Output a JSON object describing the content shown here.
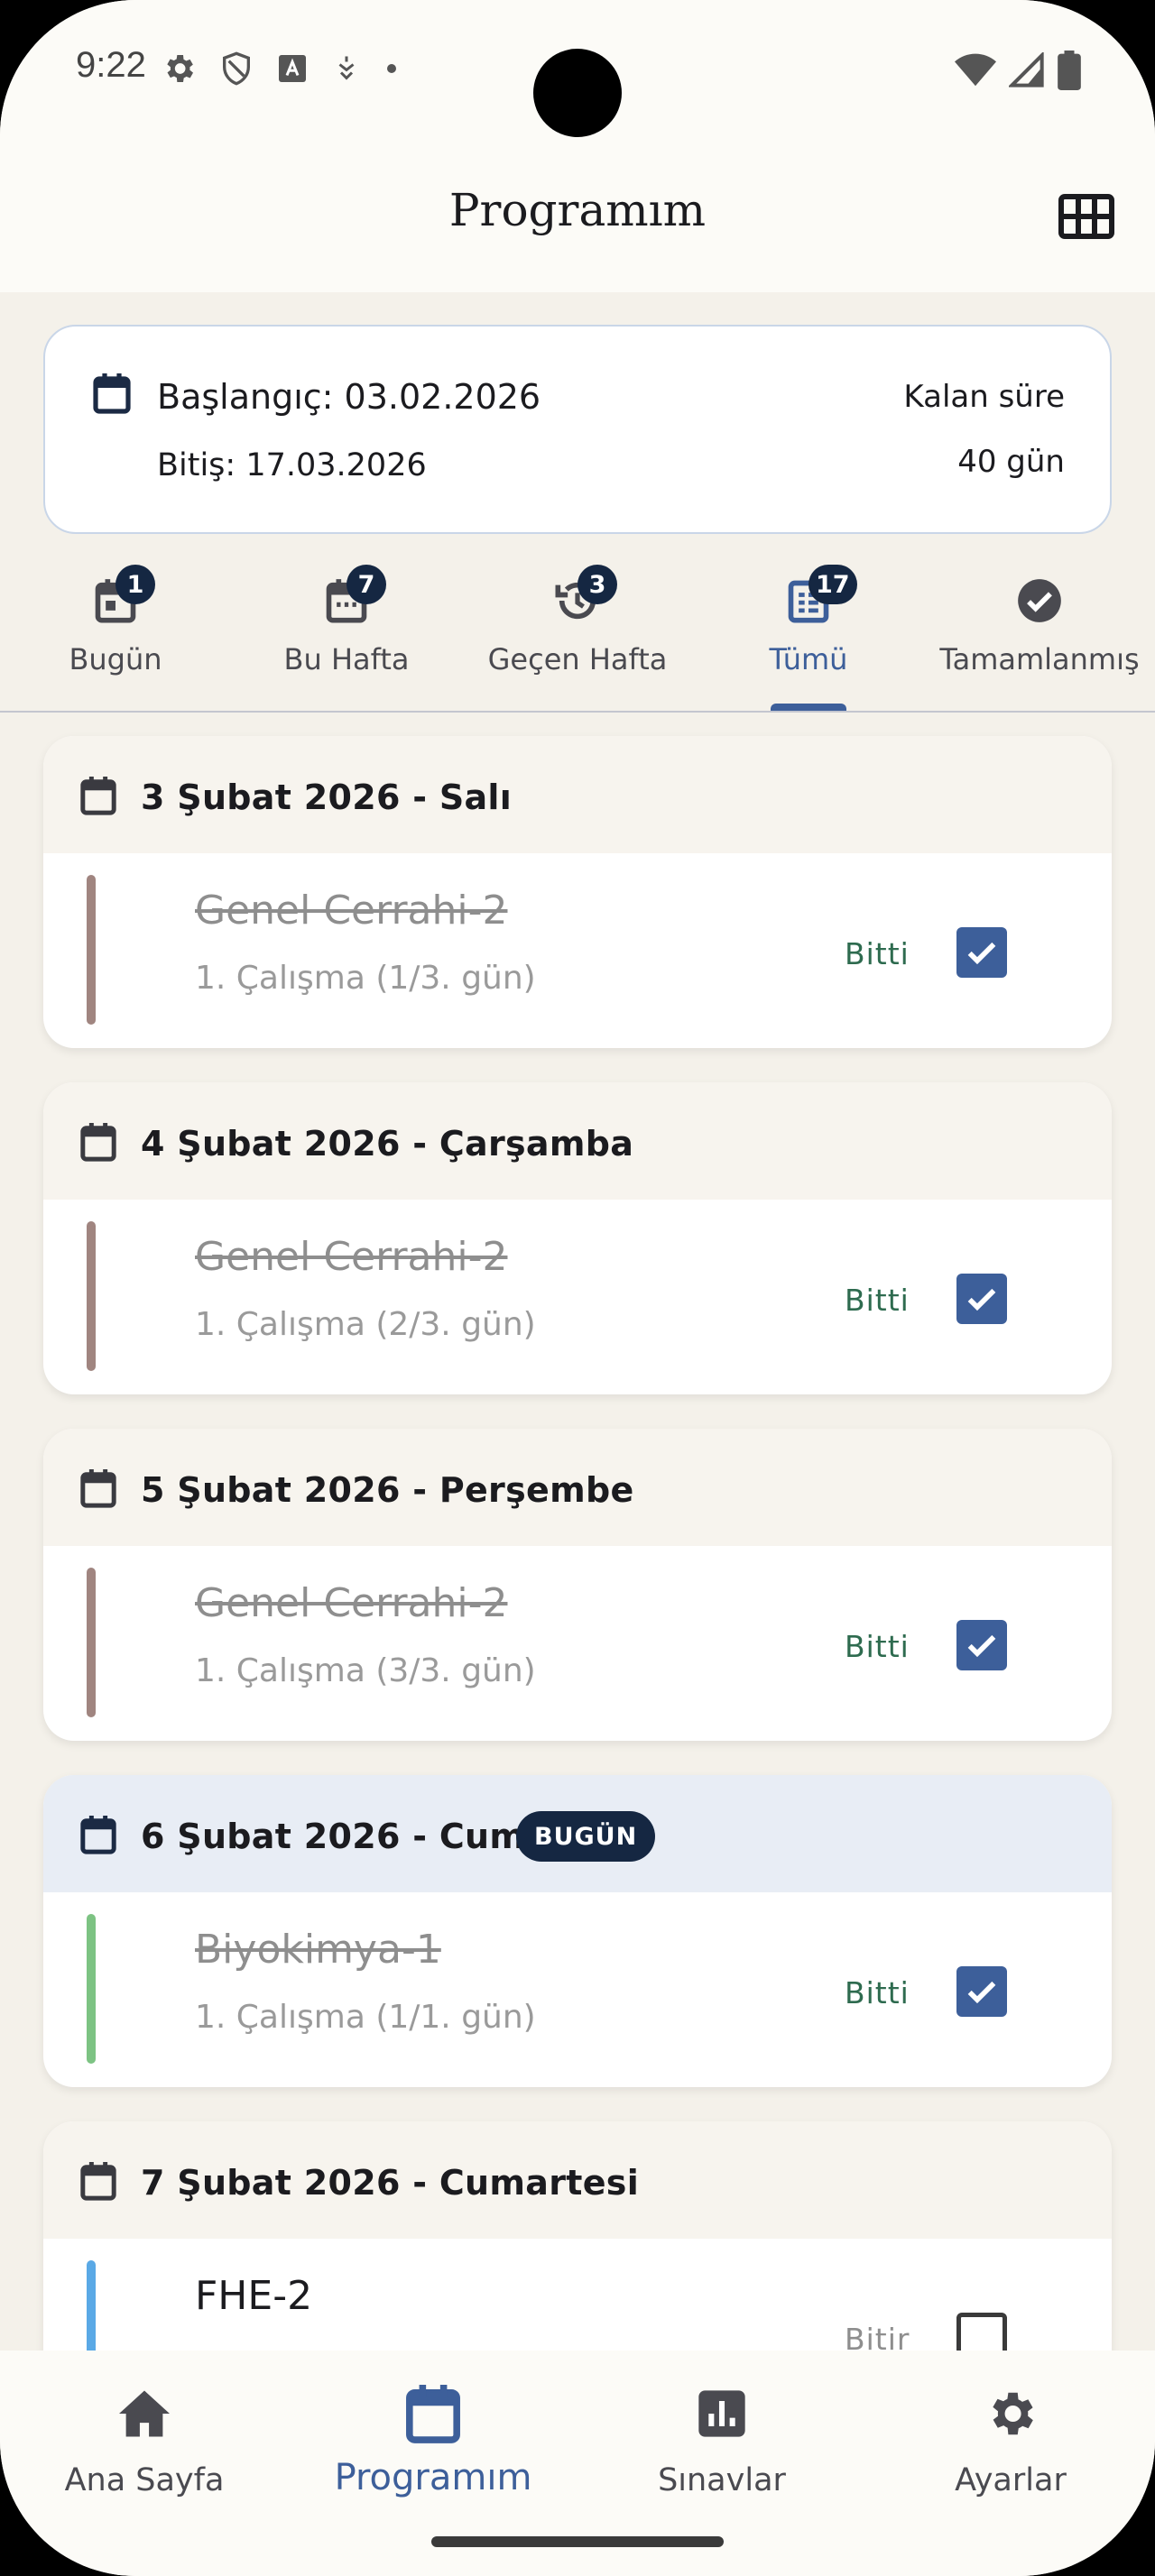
{
  "status_bar": {
    "time": "9:22"
  },
  "app_bar": {
    "title": "Programım"
  },
  "range": {
    "start": "Başlangıç: 03.02.2026",
    "end": "Bitiş: 17.03.2026",
    "remaining_label": "Kalan süre",
    "remaining_value": "40 gün"
  },
  "tabs": [
    {
      "label": "Bugün",
      "badge": "1",
      "icon": "calendar-today-icon",
      "active": false
    },
    {
      "label": "Bu Hafta",
      "badge": "7",
      "icon": "calendar-week-icon",
      "active": false
    },
    {
      "label": "Geçen Hafta",
      "badge": "3",
      "icon": "history-icon",
      "active": false
    },
    {
      "label": "Tümü",
      "badge": "17",
      "icon": "list-icon",
      "active": true
    },
    {
      "label": "Tamamlanmış",
      "badge": "",
      "icon": "check-circle-icon",
      "active": false
    }
  ],
  "days": [
    {
      "date": "3 Şubat 2026 - Salı",
      "today_badge": "",
      "task": {
        "title": "Genel Cerrahi-2",
        "subtitle": "1. Çalışma (1/3. gün)",
        "status": "Bitti",
        "done": true,
        "color": "#a08580"
      }
    },
    {
      "date": "4 Şubat 2026 - Çarşamba",
      "today_badge": "",
      "task": {
        "title": "Genel Cerrahi-2",
        "subtitle": "1. Çalışma (2/3. gün)",
        "status": "Bitti",
        "done": true,
        "color": "#a08580"
      }
    },
    {
      "date": "5 Şubat 2026 - Perşembe",
      "today_badge": "",
      "task": {
        "title": "Genel Cerrahi-2",
        "subtitle": "1. Çalışma (3/3. gün)",
        "status": "Bitti",
        "done": true,
        "color": "#a08580"
      }
    },
    {
      "date": "6 Şubat 2026 - Cuma",
      "today_badge": "BUGÜN",
      "task": {
        "title": "Biyokimya-1",
        "subtitle": "1. Çalışma (1/1. gün)",
        "status": "Bitti",
        "done": true,
        "color": "#7dc383"
      }
    },
    {
      "date": "7 Şubat 2026 - Cumartesi",
      "today_badge": "",
      "task": {
        "title": "FHE-2",
        "subtitle": "",
        "status": "Bitir",
        "done": false,
        "color": "#5aa9e6"
      }
    }
  ],
  "bottom_nav": [
    {
      "label": "Ana Sayfa",
      "icon": "home-icon",
      "active": false
    },
    {
      "label": "Programım",
      "icon": "calendar-icon",
      "active": true
    },
    {
      "label": "Sınavlar",
      "icon": "bar-chart-icon",
      "active": false
    },
    {
      "label": "Ayarlar",
      "icon": "gear-icon",
      "active": false
    }
  ],
  "colors": {
    "accent": "#3d5f9a",
    "badge": "#152742",
    "done_text": "#2e6b4f"
  }
}
